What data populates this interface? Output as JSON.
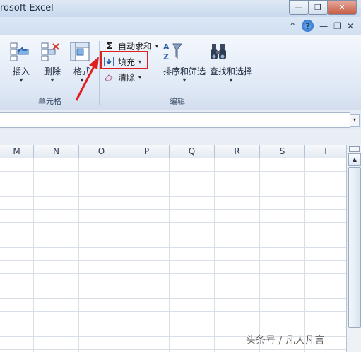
{
  "window": {
    "title": "rosoft Excel",
    "minimize_glyph": "—",
    "restore_glyph": "❐",
    "close_glyph": "✕"
  },
  "help_row": {
    "collapse_glyph": "⌃",
    "help_glyph": "?",
    "minimize_glyph": "—",
    "restore_glyph": "❐",
    "close_glyph": "✕"
  },
  "cells_group": {
    "label": "单元格",
    "insert_label": "插入",
    "delete_label": "删除",
    "format_label": "格式",
    "dropdown_glyph": "▾"
  },
  "editing_group": {
    "label": "编辑",
    "autosum_symbol": "Σ",
    "autosum_label": "自动求和",
    "fill_label": "填充",
    "clear_label": "清除",
    "sort_filter_label": "排序和筛选",
    "find_select_label": "查找和选择",
    "dropdown_glyph": "▾"
  },
  "formula_bar": {
    "expand_glyph": "▾"
  },
  "columns": [
    "M",
    "N",
    "O",
    "P",
    "Q",
    "R",
    "S",
    "T"
  ],
  "scrollbar": {
    "up_glyph": "▲"
  },
  "watermark": "头条号 / 凡人凡言",
  "colors": {
    "highlight_box": "#e02020",
    "arrow": "#e02020",
    "ribbon_bg": "#dfe8f5",
    "title_bg": "#c9d9ee"
  }
}
